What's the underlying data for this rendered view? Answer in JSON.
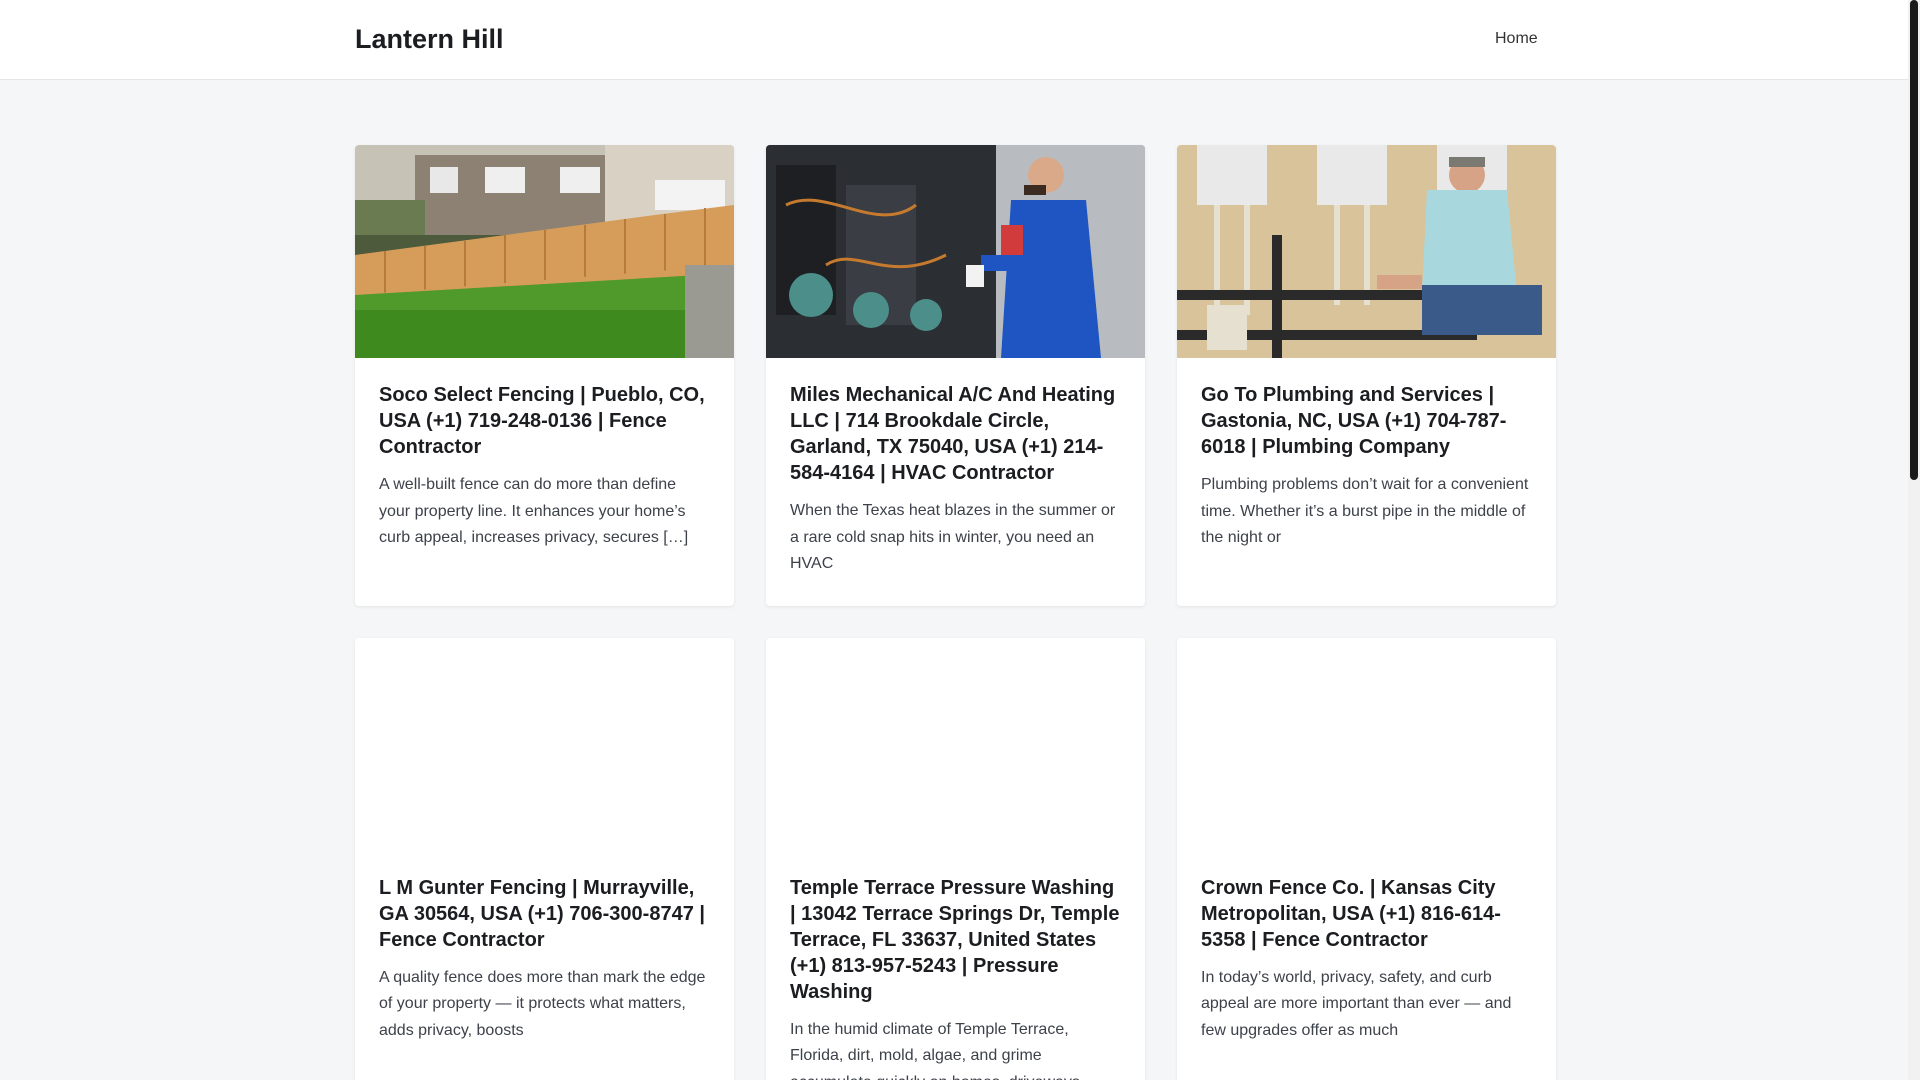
{
  "site": {
    "title": "Lantern Hill",
    "nav": [
      {
        "label": "Home"
      }
    ]
  },
  "colors": {
    "background": "#f5f6f7",
    "card": "#ffffff",
    "heading": "#1b1d21",
    "text": "#3d4149"
  },
  "posts": [
    {
      "title": "Soco Select Fencing | Pueblo, CO, USA (+1) 719-248-0136 | Fence Contractor",
      "excerpt": "A well-built fence can do more than define your property line. It enhances your home’s curb appeal, increases privacy, secures […]",
      "image": "wooden-fence-backyard-photo"
    },
    {
      "title": "Miles Mechanical A/C And Heating LLC | 714 Brookdale Circle, Garland, TX 75040, USA (+1) 214-584-4164 | HVAC Contractor",
      "excerpt": "When the Texas heat blazes in the summer or a rare cold snap hits in winter, you need an HVAC",
      "image": "hvac-technician-photo"
    },
    {
      "title": "Go To Plumbing and Services | Gastonia, NC, USA (+1) 704-787-6018 | Plumbing Company",
      "excerpt": "Plumbing problems don’t wait for a convenient time. Whether it’s a burst pipe in the middle of the night or",
      "image": "plumber-water-heaters-photo"
    },
    {
      "title": "L M Gunter Fencing | Murrayville, GA 30564, USA (+1) 706-300-8747 | Fence Contractor",
      "excerpt": "A quality fence does more than mark the edge of your property — it protects what matters, adds privacy, boosts",
      "image": "blank"
    },
    {
      "title": "Temple Terrace Pressure Washing | 13042 Terrace Springs Dr, Temple Terrace, FL 33637, United States (+1) 813-957-5243 | Pressure Washing",
      "excerpt": "In the humid climate of Temple Terrace, Florida, dirt, mold, algae, and grime accumulate quickly on homes, driveways,",
      "image": "blank"
    },
    {
      "title": "Crown Fence Co. | Kansas City Metropolitan, USA (+1) 816-614-5358 | Fence Contractor",
      "excerpt": "In today’s world, privacy, safety, and curb appeal are more important than ever — and few upgrades offer as much",
      "image": "blank"
    }
  ]
}
